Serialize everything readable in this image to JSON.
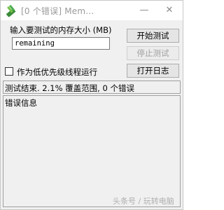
{
  "window": {
    "title": "[0 个错误] Mem...",
    "minimize_glyph": "—",
    "close_glyph": "✕",
    "app_icon": "memtest-icon"
  },
  "main": {
    "size_label": "输入要测试的内存大小 (MB)",
    "size_input_value": "remaining",
    "low_priority_label": "作为低优先级线程运行",
    "low_priority_checked": false,
    "status_text": "测试结束. 2.1% 覆盖范围, 0 个错误",
    "error_title": "错误信息"
  },
  "buttons": {
    "start": "开始测试",
    "stop": "停止测试",
    "log": "打开日志"
  },
  "watermark": "头条号 / 玩转电脑"
}
